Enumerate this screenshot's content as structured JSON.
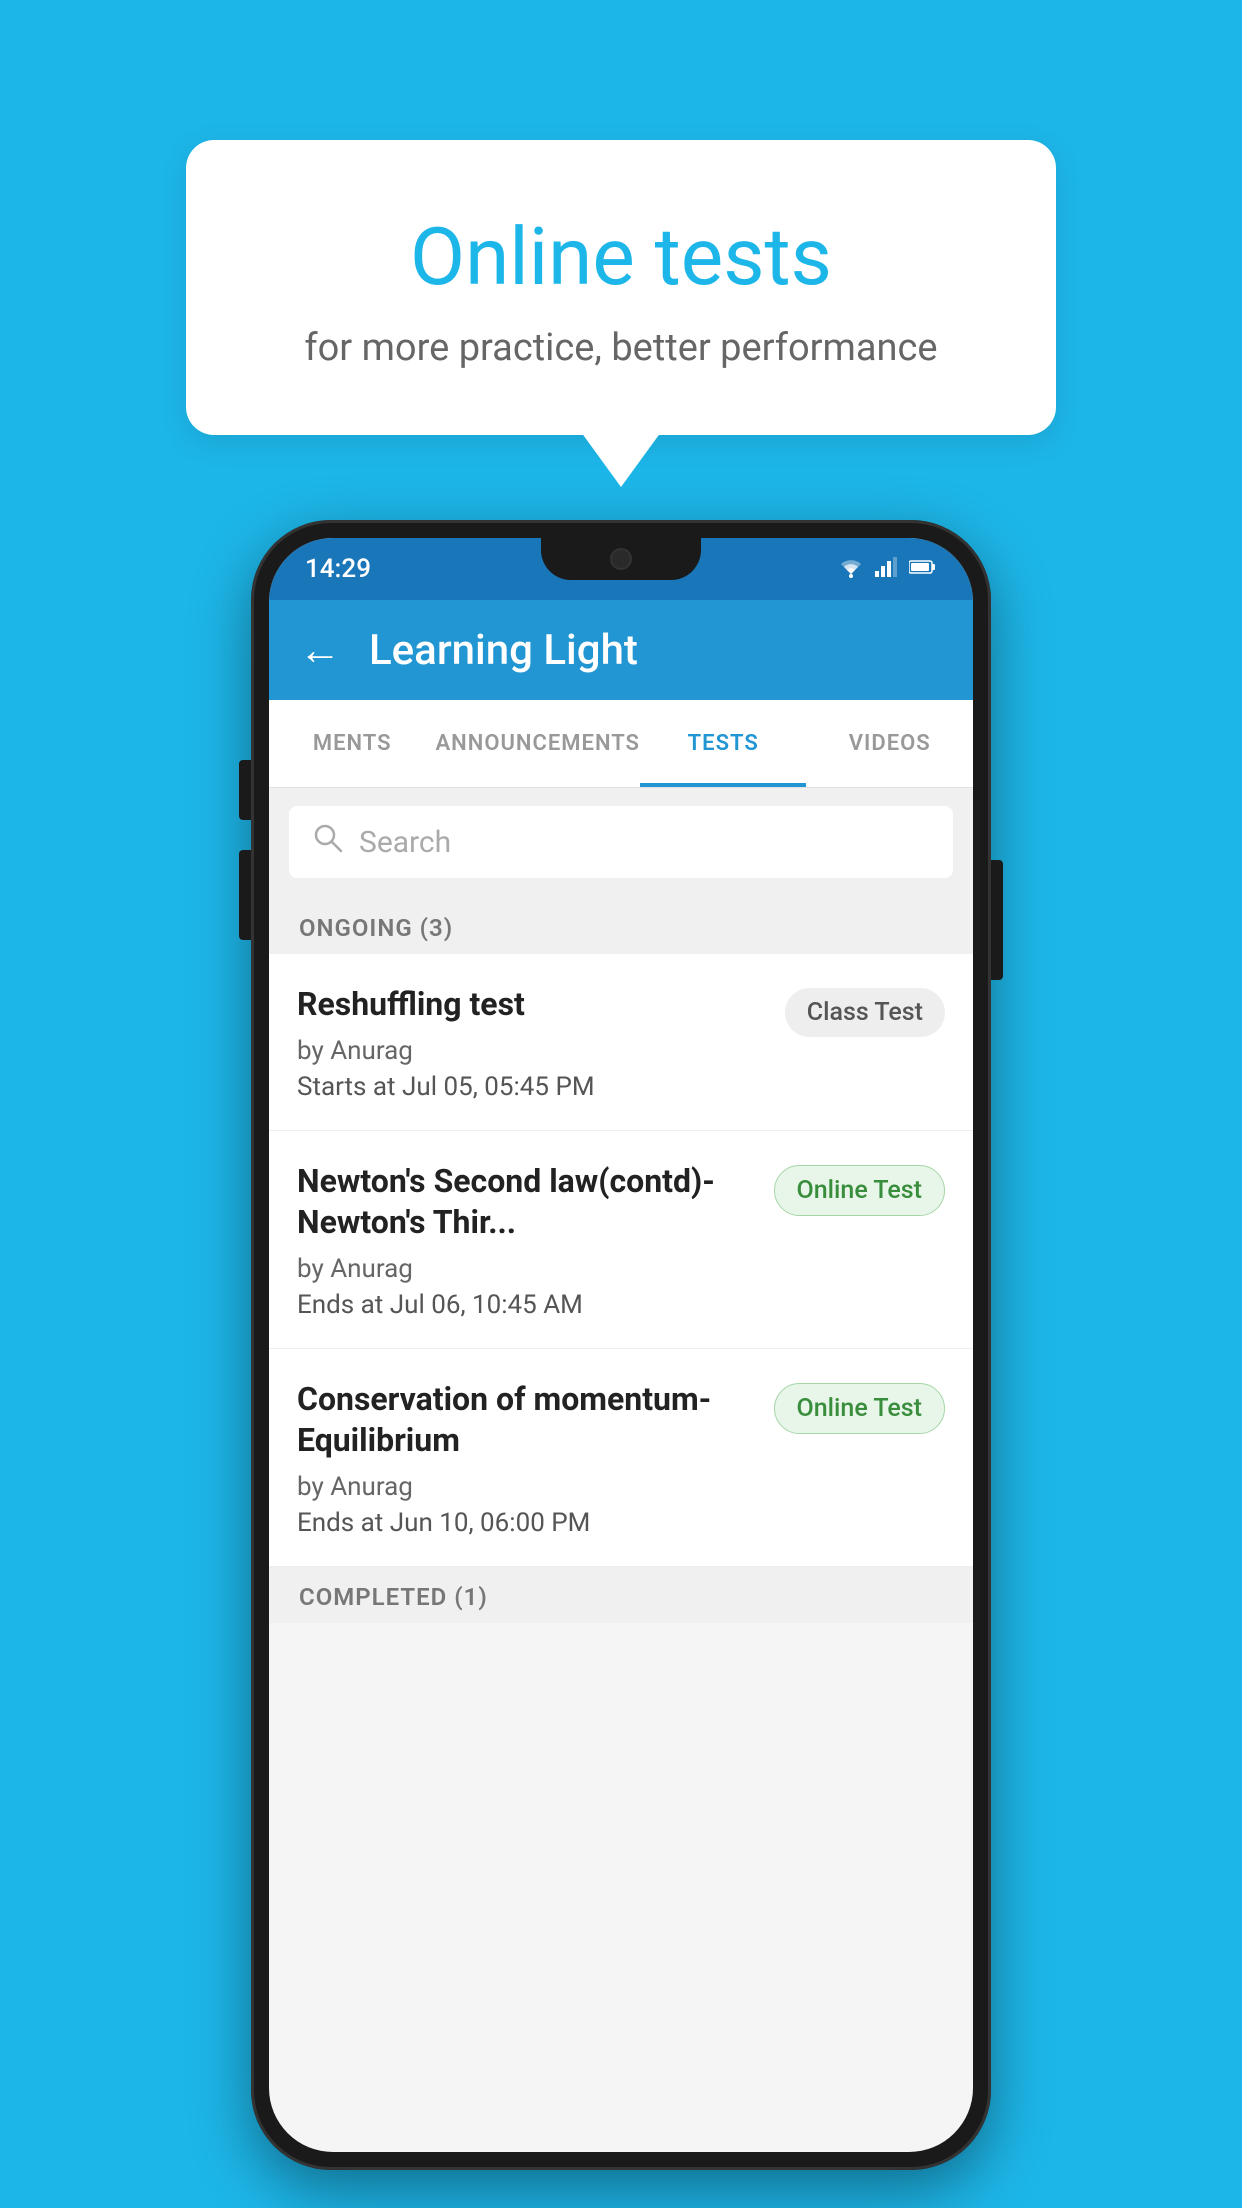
{
  "background_color": "#1db6e8",
  "speech_bubble": {
    "title": "Online tests",
    "subtitle": "for more practice, better performance"
  },
  "phone": {
    "status_bar": {
      "time": "14:29",
      "wifi": "▾",
      "signal": "▴▴",
      "battery": "▮"
    },
    "app_bar": {
      "back_label": "←",
      "title": "Learning Light"
    },
    "tabs": [
      {
        "label": "MENTS",
        "active": false
      },
      {
        "label": "ANNOUNCEMENTS",
        "active": false
      },
      {
        "label": "TESTS",
        "active": true
      },
      {
        "label": "VIDEOS",
        "active": false
      }
    ],
    "search": {
      "placeholder": "Search"
    },
    "sections": [
      {
        "label": "ONGOING (3)",
        "tests": [
          {
            "name": "Reshuffling test",
            "author": "by Anurag",
            "time_label": "Starts at",
            "time": "Jul 05, 05:45 PM",
            "badge": "Class Test",
            "badge_type": "class"
          },
          {
            "name": "Newton's Second law(contd)-Newton's Thir...",
            "author": "by Anurag",
            "time_label": "Ends at",
            "time": "Jul 06, 10:45 AM",
            "badge": "Online Test",
            "badge_type": "online"
          },
          {
            "name": "Conservation of momentum-Equilibrium",
            "author": "by Anurag",
            "time_label": "Ends at",
            "time": "Jun 10, 06:00 PM",
            "badge": "Online Test",
            "badge_type": "online"
          }
        ]
      }
    ],
    "completed_label": "COMPLETED (1)"
  }
}
